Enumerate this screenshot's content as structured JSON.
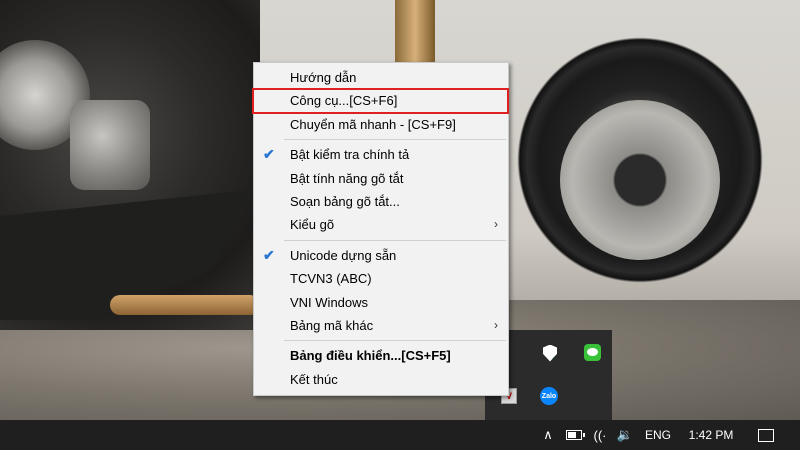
{
  "menu": {
    "items": [
      {
        "label": "Hướng dẫn",
        "checked": false,
        "submenu": false,
        "bold": false
      },
      {
        "label": "Công cụ...[CS+F6]",
        "checked": false,
        "submenu": false,
        "bold": false,
        "highlighted": true
      },
      {
        "label": "Chuyển mã nhanh - [CS+F9]",
        "checked": false,
        "submenu": false,
        "bold": false
      },
      {
        "label": "Bật kiểm tra chính tả",
        "checked": true,
        "submenu": false,
        "bold": false
      },
      {
        "label": "Bật tính năng gõ tắt",
        "checked": false,
        "submenu": false,
        "bold": false
      },
      {
        "label": "Soạn bảng gõ tắt...",
        "checked": false,
        "submenu": false,
        "bold": false
      },
      {
        "label": "Kiểu gõ",
        "checked": false,
        "submenu": true,
        "bold": false
      },
      {
        "label": "Unicode dựng sẵn",
        "checked": true,
        "submenu": false,
        "bold": false
      },
      {
        "label": "TCVN3 (ABC)",
        "checked": false,
        "submenu": false,
        "bold": false
      },
      {
        "label": "VNI Windows",
        "checked": false,
        "submenu": false,
        "bold": false
      },
      {
        "label": "Bảng mã khác",
        "checked": false,
        "submenu": true,
        "bold": false
      },
      {
        "label": "Bảng điều khiển...[CS+F5]",
        "checked": false,
        "submenu": false,
        "bold": true
      },
      {
        "label": "Kết thúc",
        "checked": false,
        "submenu": false,
        "bold": false
      }
    ],
    "check_glyph": "✔",
    "arrow_glyph": "›",
    "highlight_color": "#e02020",
    "check_color": "#2a78d2"
  },
  "tray_popup": {
    "icons": [
      "windows-security-icon",
      "line-app-icon",
      "unikey-icon",
      "zalo-icon"
    ],
    "zalo_label": "Zalo",
    "unikey_label": "V"
  },
  "taskbar": {
    "chevron": "∧",
    "wifi": "((·",
    "volume": "🔉",
    "language": "ENG",
    "time": "1:42 PM"
  }
}
